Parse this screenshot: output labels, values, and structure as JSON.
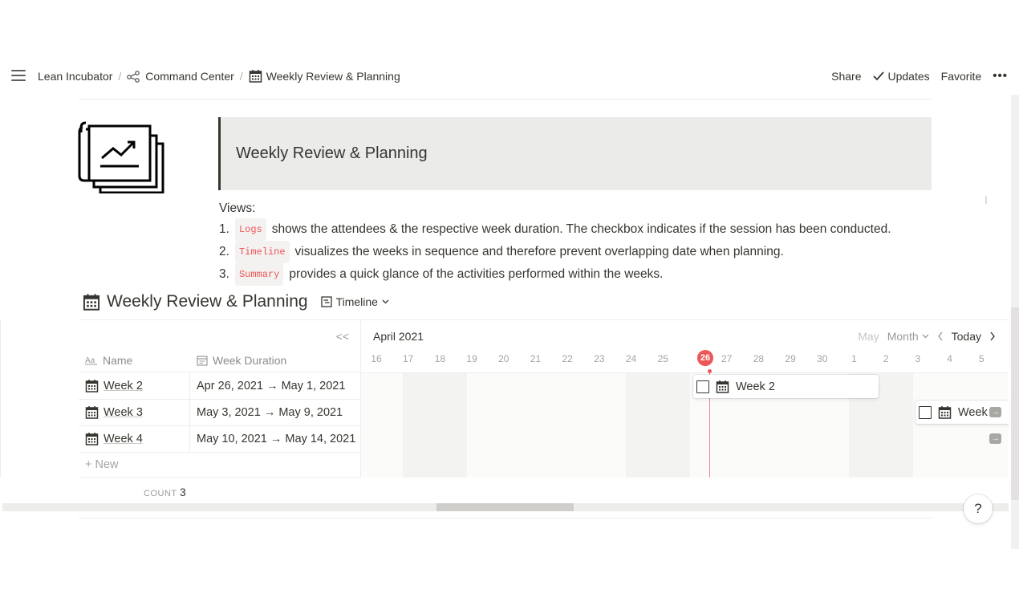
{
  "breadcrumbs": [
    {
      "label": "Lean Incubator",
      "icon": "none"
    },
    {
      "label": "Command Center",
      "icon": "share-nodes-icon"
    },
    {
      "label": "Weekly Review & Planning",
      "icon": "calendar-icon"
    }
  ],
  "topbar": {
    "share": "Share",
    "updates": "Updates",
    "favorite": "Favorite",
    "more": "•••"
  },
  "page": {
    "title": "Weekly Review & Planning",
    "views_heading": "Views:",
    "views": [
      {
        "num": "1.",
        "code": "Logs",
        "text": "shows the attendees & the respective week duration. The checkbox indicates if the session has been conducted."
      },
      {
        "num": "2.",
        "code": "Timeline",
        "text": "visualizes the weeks in sequence and therefore prevent overlapping date when planning."
      },
      {
        "num": "3.",
        "code": "Summary",
        "text": "provides a quick glance of the activities performed within the weeks."
      }
    ]
  },
  "database": {
    "title": "Weekly Review & Planning",
    "view_name": "Timeline",
    "collapse": "<<",
    "columns": {
      "name": "Name",
      "duration": "Week Duration"
    },
    "rows": [
      {
        "name": "Week 2",
        "duration": "Apr 26, 2021 → May 1, 2021"
      },
      {
        "name": "Week 3",
        "duration": "May 3, 2021 → May 9, 2021"
      },
      {
        "name": "Week 4",
        "duration": "May 10, 2021 → May 14, 2021"
      }
    ],
    "new_label": "New",
    "count_label": "COUNT",
    "count_value": "3"
  },
  "timeline": {
    "month_label": "April 2021",
    "next_month_label": "May",
    "scale": "Month",
    "today_label": "Today",
    "days": [
      "16",
      "17",
      "18",
      "19",
      "20",
      "21",
      "22",
      "23",
      "24",
      "25",
      "26",
      "27",
      "28",
      "29",
      "30",
      "1",
      "2",
      "3",
      "4",
      "5"
    ],
    "today": "26",
    "cards": [
      {
        "label": "Week 2"
      },
      {
        "label": "Week"
      }
    ]
  },
  "help": "?",
  "colors": {
    "accent_red": "#eb5757",
    "text": "#37352f",
    "muted": "#9b9a97"
  }
}
